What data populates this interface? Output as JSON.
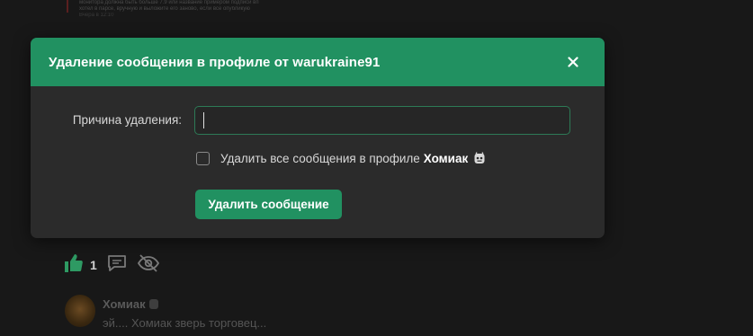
{
  "background": {
    "post_text_lines": [
      "монитора должна быть больше 7.9 или название примером подписи вп",
      "хотел в парсе, вручную и выложите его заново, если все опубликую",
      "Вчера в 12:10"
    ],
    "likes_count": "1",
    "comment": {
      "author": "Хомиак",
      "text": "эй.... Хомиак зверь торговец..."
    }
  },
  "modal": {
    "title": "Удаление сообщения в профиле от warukraine91",
    "reason_label": "Причина удаления:",
    "reason_value": "",
    "reason_placeholder": "",
    "checkbox_text": "Удалить все сообщения в профиле",
    "checkbox_name": "Хомиак",
    "checkbox_checked": false,
    "submit_label": "Удалить сообщение"
  },
  "colors": {
    "accent": "#219161",
    "modal_bg": "#2b2b2b",
    "page_bg": "#181818",
    "input_border": "#2d7a56"
  },
  "icons": {
    "close": "close-icon",
    "badge": "user-badge-icon",
    "like": "thumbs-up-icon",
    "comment": "comment-icon",
    "hide": "eye-off-icon"
  }
}
